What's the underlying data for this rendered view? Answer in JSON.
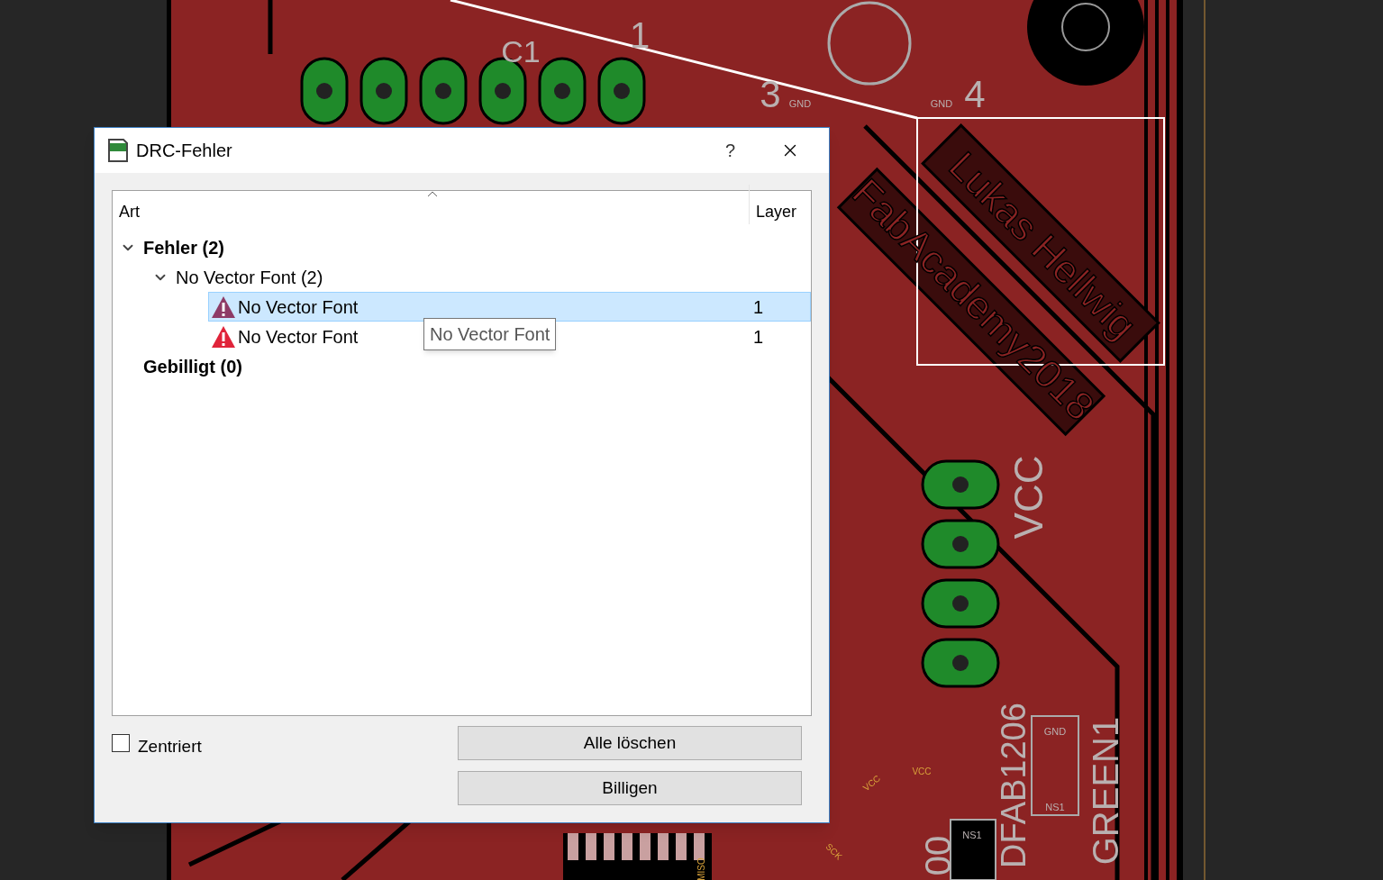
{
  "pcb": {
    "labels": [
      {
        "text": "C1",
        "kind": "silk"
      },
      {
        "text": "1",
        "kind": "silk"
      },
      {
        "text": "3",
        "kind": "silk"
      },
      {
        "text": "GND",
        "kind": "silk"
      },
      {
        "text": "GND",
        "kind": "silk"
      },
      {
        "text": "4",
        "kind": "silk"
      },
      {
        "text": "Lukas Hellwig",
        "kind": "engraved"
      },
      {
        "text": "FabAcademy2018",
        "kind": "engraved"
      },
      {
        "text": "VCC",
        "kind": "silk"
      },
      {
        "text": "DFAB1206",
        "kind": "silk"
      },
      {
        "text": "GREEN1",
        "kind": "silk"
      },
      {
        "text": "00",
        "kind": "silk"
      },
      {
        "text": "GND",
        "kind": "silk"
      },
      {
        "text": "NS1",
        "kind": "silk"
      },
      {
        "text": "NS1",
        "kind": "silk"
      },
      {
        "text": "VCC",
        "kind": "net"
      },
      {
        "text": "VCC",
        "kind": "net"
      },
      {
        "text": "SCK",
        "kind": "net"
      },
      {
        "text": "MISO",
        "kind": "net"
      }
    ]
  },
  "dialog": {
    "title": "DRC-Fehler",
    "help": "?",
    "columns": [
      "Art",
      "Layer"
    ],
    "tree": [
      {
        "label": "Fehler (2)",
        "expanded": true,
        "children": [
          {
            "label": "No Vector Font (2)",
            "expanded": true,
            "children": [
              {
                "label": "No Vector Font",
                "layer": "1",
                "selected": true
              },
              {
                "label": "No Vector Font",
                "layer": "1",
                "selected": false
              }
            ]
          }
        ]
      },
      {
        "label": "Gebilligt (0)"
      }
    ],
    "tooltip": "No Vector Font",
    "checkbox": {
      "label": "Zentriert",
      "checked": false
    },
    "buttons": [
      "Alle löschen",
      "Billigen"
    ]
  }
}
